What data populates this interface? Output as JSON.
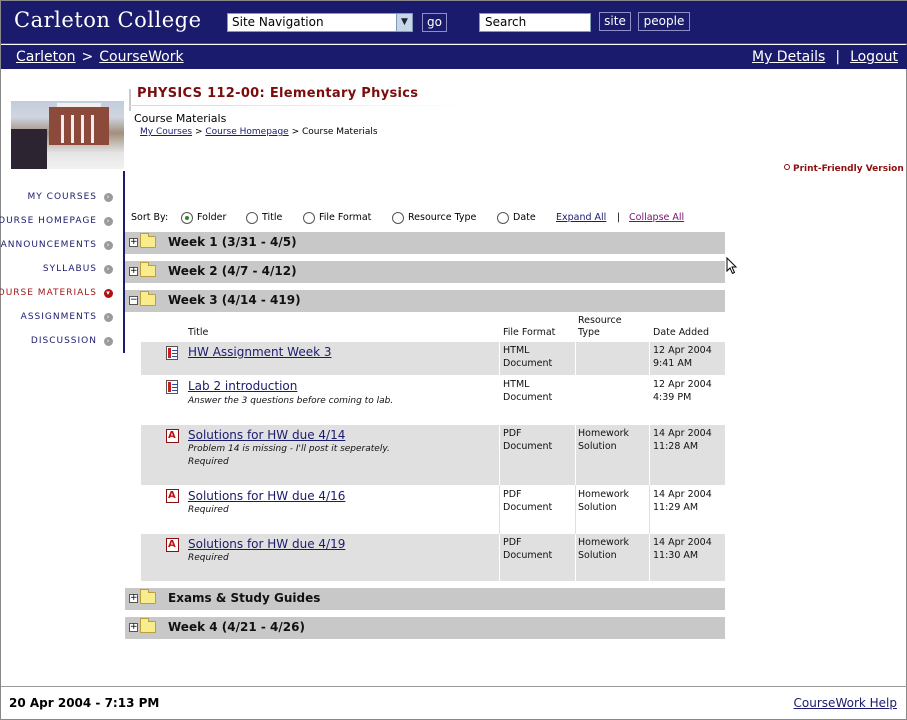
{
  "header": {
    "brand": "Carleton College",
    "site_nav": {
      "selected": "Site Navigation"
    },
    "go_label": "go",
    "search_placeholder": "Search",
    "site_label": "site",
    "people_label": "people"
  },
  "subbar": {
    "crumbs": [
      "Carleton",
      "CourseWork"
    ],
    "separator": ">",
    "my_details": "My Details",
    "logout": "Logout",
    "divider": "|"
  },
  "sidebar": {
    "items": [
      {
        "label": "MY COURSES",
        "active": false
      },
      {
        "label": "COURSE HOMEPAGE",
        "active": false
      },
      {
        "label": "ANNOUNCEMENTS",
        "active": false
      },
      {
        "label": "SYLLABUS",
        "active": false
      },
      {
        "label": "COURSE MATERIALS",
        "active": true
      },
      {
        "label": "ASSIGNMENTS",
        "active": false
      },
      {
        "label": "DISCUSSION",
        "active": false
      }
    ]
  },
  "course": {
    "title": "PHYSICS 112-00: Elementary Physics",
    "section": "Course Materials",
    "breadcrumb": {
      "my_courses": "My Courses",
      "sep": ">",
      "homepage": "Course Homepage",
      "current": "Course Materials"
    },
    "print_friendly": "Print-Friendly Version"
  },
  "sort": {
    "label": "Sort By:",
    "options": [
      "Folder",
      "Title",
      "File Format",
      "Resource Type",
      "Date"
    ],
    "selected": "Folder",
    "expand_all": "Expand All",
    "divider": "|",
    "collapse_all": "Collapse All"
  },
  "folders": [
    {
      "name": "Week 1 (3/31 - 4/5)",
      "expanded": false
    },
    {
      "name": "Week 2 (4/7 - 4/12)",
      "expanded": false
    },
    {
      "name": "Week 3 (4/14 - 419)",
      "expanded": true
    },
    {
      "name": "Exams & Study Guides",
      "expanded": false
    },
    {
      "name": "Week 4 (4/21 - 4/26)",
      "expanded": false
    }
  ],
  "table": {
    "headers": {
      "title": "Title",
      "file_format": "File Format",
      "resource_type_1": "Resource",
      "resource_type_2": "Type",
      "date_added": "Date Added"
    },
    "rows": [
      {
        "icon": "html-document-icon",
        "title": "HW Assignment Week 3",
        "desc": "",
        "required": "",
        "format_1": "HTML",
        "format_2": "Document",
        "type_1": "",
        "type_2": "",
        "date": "12 Apr 2004",
        "time": "9:41 AM"
      },
      {
        "icon": "html-document-icon",
        "title": "Lab 2 introduction",
        "desc": "Answer the 3 questions before coming to lab.",
        "required": "",
        "format_1": "HTML",
        "format_2": "Document",
        "type_1": "",
        "type_2": "",
        "date": "12 Apr 2004",
        "time": "4:39 PM"
      },
      {
        "icon": "pdf-document-icon",
        "title": "Solutions for HW due 4/14",
        "desc": "Problem 14 is missing - I'll post it seperately.",
        "required": "Required",
        "format_1": "PDF",
        "format_2": "Document",
        "type_1": "Homework",
        "type_2": "Solution",
        "date": "14 Apr 2004",
        "time": "11:28 AM"
      },
      {
        "icon": "pdf-document-icon",
        "title": "Solutions for HW due 4/16",
        "desc": "",
        "required": "Required",
        "format_1": "PDF",
        "format_2": "Document",
        "type_1": "Homework",
        "type_2": "Solution",
        "date": "14 Apr 2004",
        "time": "11:29 AM"
      },
      {
        "icon": "pdf-document-icon",
        "title": "Solutions for HW due 4/19",
        "desc": "",
        "required": "Required",
        "format_1": "PDF",
        "format_2": "Document",
        "type_1": "Homework",
        "type_2": "Solution",
        "date": "14 Apr 2004",
        "time": "11:30 AM"
      }
    ]
  },
  "footer": {
    "datetime": "20 Apr 2004 - 7:13 PM",
    "help": "CourseWork Help"
  },
  "colors": {
    "navy": "#1b1b6e",
    "maroon": "#7a0c0c",
    "folder_bar": "#c8c8c8",
    "row_shade": "#e0e0e0"
  }
}
